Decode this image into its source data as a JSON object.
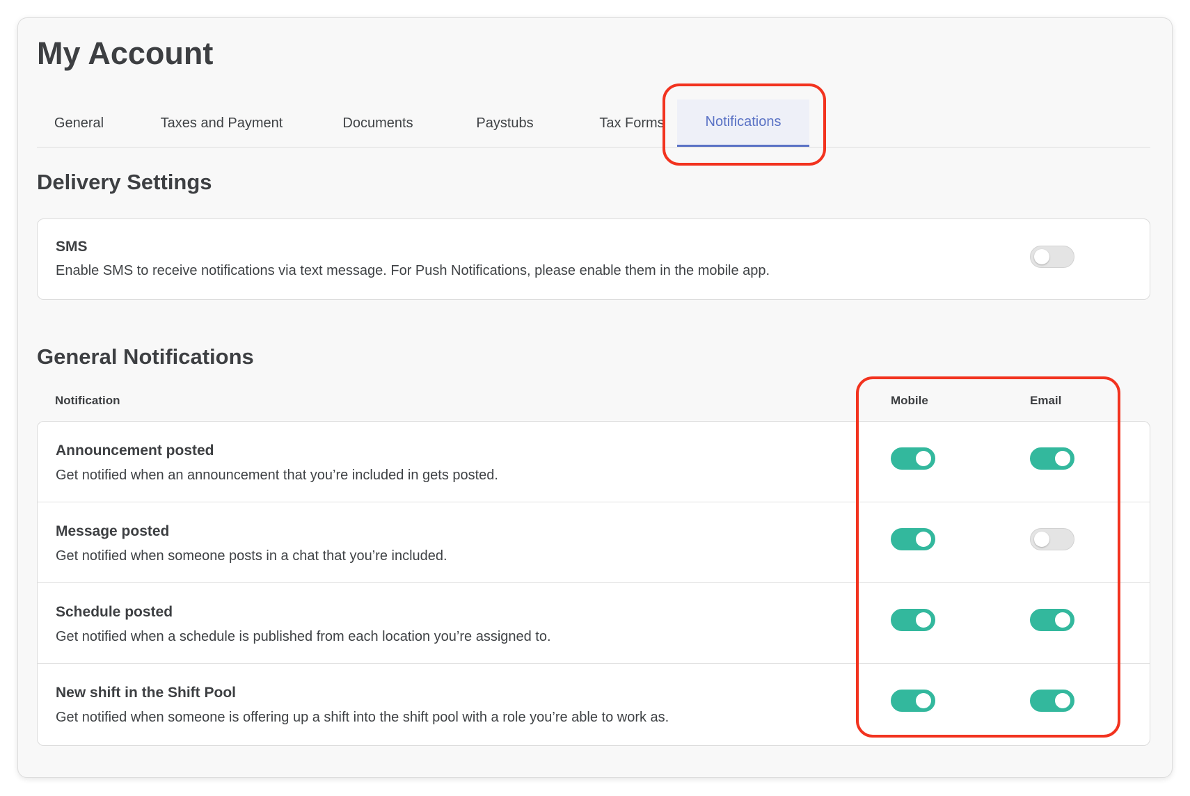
{
  "page": {
    "title": "My Account"
  },
  "tabs": [
    {
      "label": "General",
      "active": false
    },
    {
      "label": "Taxes and Payment",
      "active": false
    },
    {
      "label": "Documents",
      "active": false
    },
    {
      "label": "Paystubs",
      "active": false
    },
    {
      "label": "Tax Forms",
      "active": false
    },
    {
      "label": "Notifications",
      "active": true
    }
  ],
  "delivery": {
    "title": "Delivery Settings",
    "sms": {
      "title": "SMS",
      "description": "Enable SMS to receive notifications via text message. For Push Notifications, please enable them in the mobile app.",
      "enabled": false
    }
  },
  "general": {
    "title": "General Notifications",
    "columns": {
      "notification": "Notification",
      "mobile": "Mobile",
      "email": "Email"
    },
    "rows": [
      {
        "title": "Announcement posted",
        "description": "Get notified when an announcement that you’re included in gets posted.",
        "mobile": true,
        "email": true
      },
      {
        "title": "Message posted",
        "description": "Get notified when someone posts in a chat that you’re included.",
        "mobile": true,
        "email": false
      },
      {
        "title": "Schedule posted",
        "description": "Get notified when a schedule is published from each location you’re assigned to.",
        "mobile": true,
        "email": true
      },
      {
        "title": "New shift in the Shift Pool",
        "description": "Get notified when someone is offering up a shift into the shift pool with a role you’re able to work as.",
        "mobile": true,
        "email": true
      }
    ]
  },
  "colors": {
    "accent": "#5a72c5",
    "toggle_on": "#33b89d",
    "toggle_off": "#e4e4e4",
    "highlight": "#f2331f"
  }
}
